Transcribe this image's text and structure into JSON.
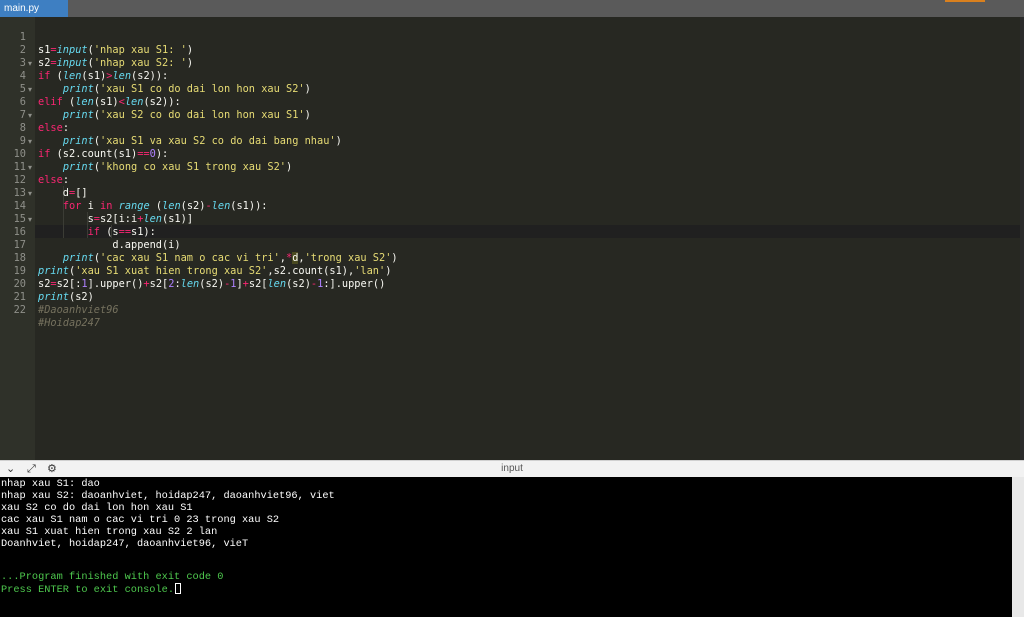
{
  "tab": {
    "filename": "main.py"
  },
  "editor": {
    "line_numbers": [
      "1",
      "2",
      "3",
      "4",
      "5",
      "6",
      "7",
      "8",
      "9",
      "10",
      "11",
      "12",
      "13",
      "14",
      "15",
      "16",
      "17",
      "18",
      "19",
      "20",
      "21",
      "22"
    ],
    "comments": [
      "#Daoanhviet96",
      "#Hoidap247"
    ]
  },
  "console": {
    "title": "input",
    "lines": [
      "nhap xau S1: dao",
      "nhap xau S2: daoanhviet, hoidap247, daoanhviet96, viet",
      "xau S2 co do dai lon hon xau S1",
      "cac xau S1 nam o cac vi tri 0 23 trong xau S2",
      "xau S1 xuat hien trong xau S2 2 lan",
      "Doanhviet, hoidap247, daoanhviet96, vieT"
    ],
    "finish_message": "...Program finished with exit code 0",
    "prompt": "Press ENTER to exit console."
  },
  "icons": {
    "collapse": "chevron-down-icon",
    "expand": "expand-icon",
    "settings": "gear-icon"
  }
}
